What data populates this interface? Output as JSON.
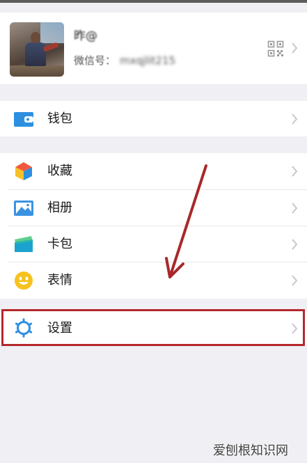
{
  "profile": {
    "name": "昨@",
    "wechat_id_label": "微信号：",
    "wechat_id": "mxqjlit215",
    "avatar_icon": "avatar-photo",
    "qr_icon": "qr-code-icon"
  },
  "menu": {
    "wallet": {
      "label": "钱包",
      "icon": "wallet-icon"
    },
    "group": [
      {
        "label": "收藏",
        "icon": "favorites-cube-icon"
      },
      {
        "label": "相册",
        "icon": "album-icon"
      },
      {
        "label": "卡包",
        "icon": "card-pack-icon"
      },
      {
        "label": "表情",
        "icon": "sticker-smiley-icon"
      }
    ],
    "settings": {
      "label": "设置",
      "icon": "gear-icon"
    }
  },
  "annotation": {
    "highlight_color": "#b3282c",
    "arrow_color": "#a8282a"
  },
  "watermark": {
    "text": "爱刨根知识网"
  },
  "colors": {
    "background": "#efeff4",
    "row": "#ffffff",
    "icon_blue": "#2d8fe0",
    "chevron": "#c7c7cc",
    "divider": "#e6e6e6"
  }
}
